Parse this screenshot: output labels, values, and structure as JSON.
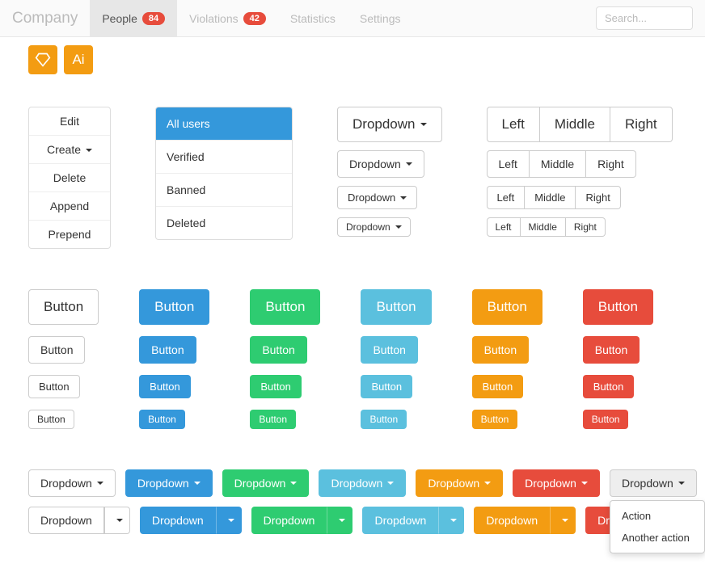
{
  "navbar": {
    "brand": "Company",
    "items": [
      {
        "label": "People",
        "badge": "84",
        "active": true
      },
      {
        "label": "Violations",
        "badge": "42"
      },
      {
        "label": "Statistics"
      },
      {
        "label": "Settings"
      }
    ],
    "search_placeholder": "Search..."
  },
  "icon_buttons": {
    "ai": "Ai"
  },
  "side_list": {
    "items": [
      "Edit",
      "Create",
      "Delete",
      "Append",
      "Prepend"
    ],
    "dropdown_index": 1
  },
  "user_list": {
    "items": [
      "All users",
      "Verified",
      "Banned",
      "Deleted"
    ],
    "active_index": 0
  },
  "dropdown_label": "Dropdown",
  "btn_group_labels": [
    "Left",
    "Middle",
    "Right"
  ],
  "button_label": "Button",
  "open_menu": {
    "items": [
      "Action",
      "Another action"
    ]
  },
  "colors": {
    "primary": "#3498db",
    "success": "#2ecc71",
    "info": "#5bc0de",
    "warning": "#f39c12",
    "danger": "#e74c3c"
  }
}
